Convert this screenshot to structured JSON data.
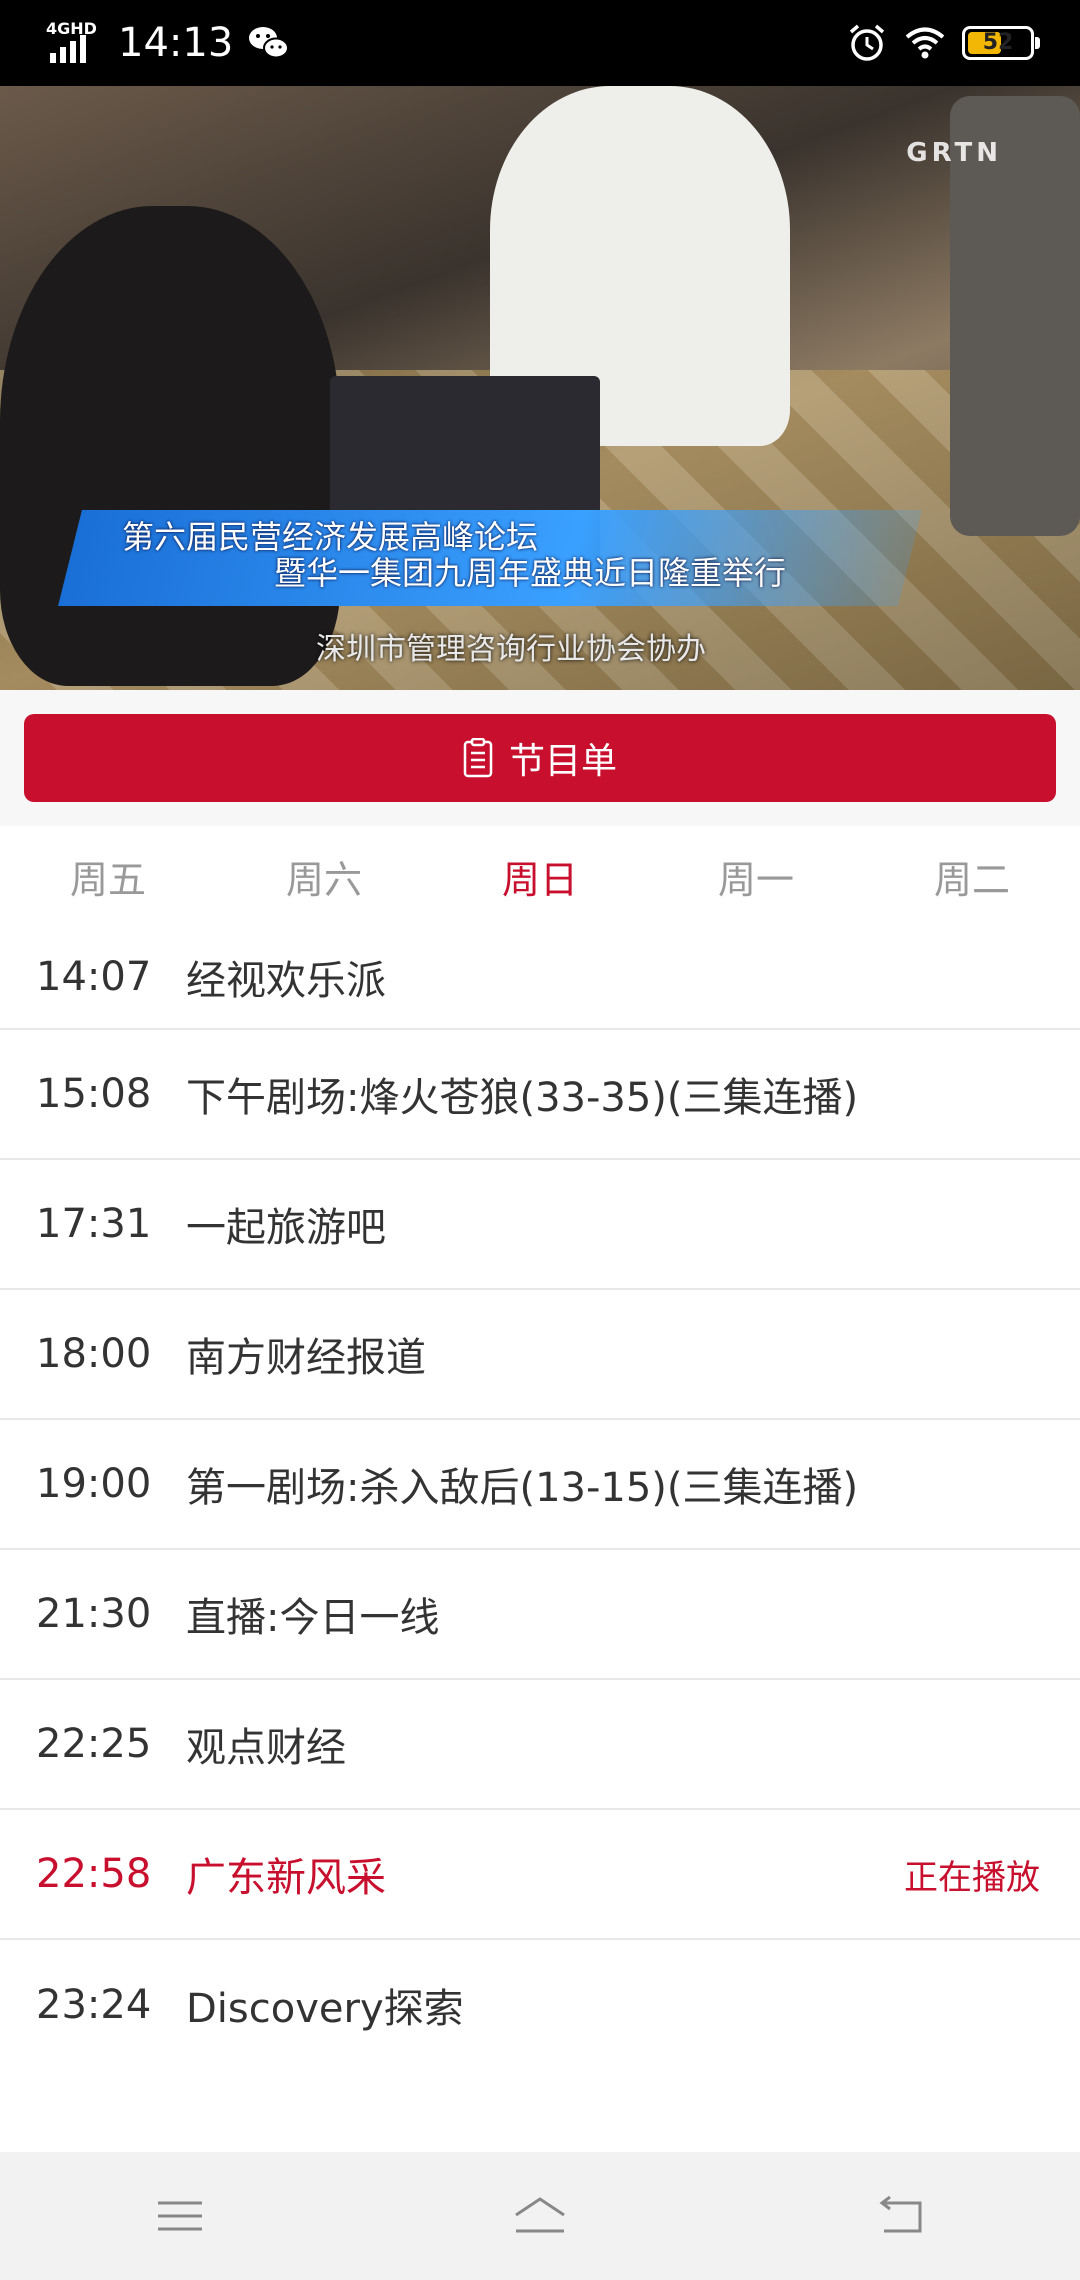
{
  "status_bar": {
    "network": "4GHD",
    "time": "14:13",
    "battery_level": "52",
    "icons": [
      "signal-icon",
      "wechat-icon",
      "alarm-icon",
      "wifi-icon",
      "battery-icon"
    ]
  },
  "video": {
    "caption_line1": "第六届民营经济发展高峰论坛",
    "caption_line2": "暨华一集团九周年盛典近日隆重举行",
    "caption_line3": "深圳市管理咨询行业协会协办",
    "watermark": "GRTN"
  },
  "program_button": {
    "label": "节目单",
    "icon": "list-icon"
  },
  "day_tabs": [
    {
      "label": "周五",
      "active": false
    },
    {
      "label": "周六",
      "active": false
    },
    {
      "label": "周日",
      "active": true
    },
    {
      "label": "周一",
      "active": false
    },
    {
      "label": "周二",
      "active": false
    }
  ],
  "schedule": [
    {
      "time": "14:07",
      "title": "经视欢乐派"
    },
    {
      "time": "15:08",
      "title": "下午剧场:烽火苍狼(33-35)(三集连播)"
    },
    {
      "time": "17:31",
      "title": "一起旅游吧"
    },
    {
      "time": "18:00",
      "title": "南方财经报道"
    },
    {
      "time": "19:00",
      "title": "第一剧场:杀入敌后(13-15)(三集连播)"
    },
    {
      "time": "21:30",
      "title": "直播:今日一线"
    },
    {
      "time": "22:25",
      "title": "观点财经"
    },
    {
      "time": "22:58",
      "title": "广东新风采",
      "badge": "正在播放",
      "current": true
    },
    {
      "time": "23:24",
      "title": "Discovery探索"
    }
  ],
  "nav_bar": {
    "icons": [
      "menu-icon",
      "home-icon",
      "back-icon"
    ]
  },
  "colors": {
    "accent": "#c8102e",
    "inactive_tab": "#999999",
    "text": "#333333"
  }
}
